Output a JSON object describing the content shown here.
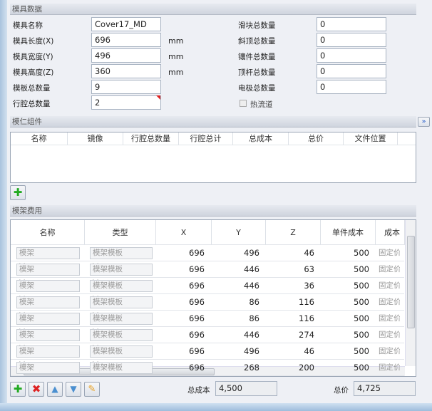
{
  "mold_data": {
    "title": "模具数据",
    "left": [
      {
        "label": "模具名称",
        "value": "Cover17_MD",
        "unit": ""
      },
      {
        "label": "模具长度(X)",
        "value": "696",
        "unit": "mm"
      },
      {
        "label": "模具宽度(Y)",
        "value": "496",
        "unit": "mm"
      },
      {
        "label": "模具高度(Z)",
        "value": "360",
        "unit": "mm"
      },
      {
        "label": "模板总数量",
        "value": "9",
        "unit": ""
      },
      {
        "label": "行腔总数量",
        "value": "2",
        "unit": ""
      }
    ],
    "right": [
      {
        "label": "滑块总数量",
        "value": "0"
      },
      {
        "label": "斜顶总数量",
        "value": "0"
      },
      {
        "label": "镶件总数量",
        "value": "0"
      },
      {
        "label": "顶杆总数量",
        "value": "0"
      },
      {
        "label": "电极总数量",
        "value": "0"
      }
    ],
    "hot_runner_label": "热流道",
    "hot_runner_checked": false
  },
  "core_assembly": {
    "title": "模仁组件",
    "expand_label": "»",
    "columns": [
      "名称",
      "镜像",
      "行腔总数量",
      "行腔总计",
      "总成本",
      "总价",
      "文件位置"
    ]
  },
  "mold_base_cost": {
    "title": "模架费用",
    "columns": [
      "名称",
      "类型",
      "X",
      "Y",
      "Z",
      "单件成本",
      "成本"
    ],
    "rows": [
      {
        "name": "模架",
        "type": "模架模板",
        "x": "696",
        "y": "496",
        "z": "46",
        "unit_cost": "500",
        "cost": "固定价"
      },
      {
        "name": "模架",
        "type": "模架模板",
        "x": "696",
        "y": "446",
        "z": "63",
        "unit_cost": "500",
        "cost": "固定价"
      },
      {
        "name": "模架",
        "type": "模架模板",
        "x": "696",
        "y": "446",
        "z": "36",
        "unit_cost": "500",
        "cost": "固定价"
      },
      {
        "name": "模架",
        "type": "模架模板",
        "x": "696",
        "y": "86",
        "z": "116",
        "unit_cost": "500",
        "cost": "固定价"
      },
      {
        "name": "模架",
        "type": "模架模板",
        "x": "696",
        "y": "86",
        "z": "116",
        "unit_cost": "500",
        "cost": "固定价"
      },
      {
        "name": "模架",
        "type": "模架模板",
        "x": "696",
        "y": "446",
        "z": "274",
        "unit_cost": "500",
        "cost": "固定价"
      },
      {
        "name": "模架",
        "type": "模架模板",
        "x": "696",
        "y": "496",
        "z": "46",
        "unit_cost": "500",
        "cost": "固定价"
      },
      {
        "name": "模架",
        "type": "模架模板",
        "x": "696",
        "y": "268",
        "z": "200",
        "unit_cost": "500",
        "cost": "固定价"
      }
    ],
    "total_cost_label": "总成本",
    "total_cost": "4,500",
    "total_price_label": "总价",
    "total_price": "4,725"
  }
}
